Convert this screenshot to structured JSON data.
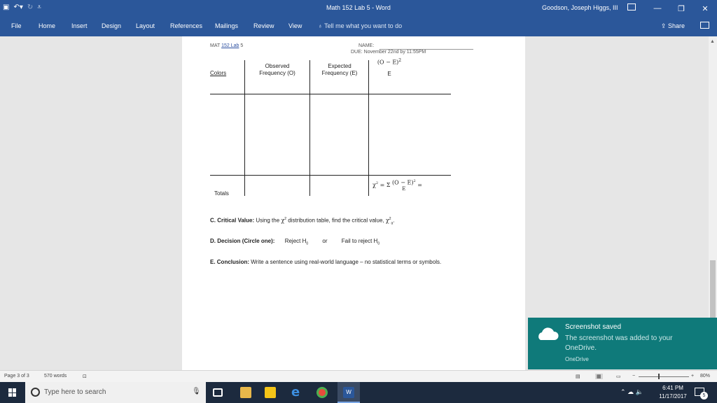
{
  "app": {
    "title": "Math 152 Lab 5  -  Word",
    "user": "Goodson, Joseph Higgs, III",
    "quick_access": [
      "save-icon",
      "undo-icon",
      "redo-icon",
      "customize-icon"
    ]
  },
  "ribbon": {
    "tabs": [
      "File",
      "Home",
      "Insert",
      "Design",
      "Layout",
      "References",
      "Mailings",
      "Review",
      "View"
    ],
    "tell_me": "Tell me what you want to do",
    "share": "Share"
  },
  "document": {
    "header_left_prefix": "MAT ",
    "header_left_ul": "152 Lab",
    "header_left_suffix": " 5",
    "name_label": "NAME:",
    "due": "DUE: November 22nd by 11:55PM",
    "table": {
      "col_colors": "Colors",
      "col_observed_1": "Observed",
      "col_observed_2": "Frequency (O)",
      "col_expected_1": "Expected",
      "col_expected_2": "Frequency (E)",
      "col_formula_num": "(O − E)",
      "col_formula_exp": "2",
      "col_formula_den": "E",
      "totals": "Totals",
      "chi_lhs": "χ",
      "chi_sup": "2",
      "chi_eq": " = Σ",
      "chi_num": "(O − E)",
      "chi_num_exp": "2",
      "chi_den": "E",
      "chi_end": " ="
    },
    "critical_value": {
      "label": "C. Critical Value:",
      "text1": " Using the ",
      "chi": "χ",
      "chi_sup": "2",
      "text2": " distribution table, find the critical value, ",
      "chi2": "χ",
      "chi2_sup": "2",
      "chi2_sub": "α",
      "text3": "."
    },
    "decision": {
      "label": "D. Decision (Circle one):",
      "reject": "Reject H",
      "reject_sub": "0",
      "or": "or",
      "fail": "Fail to reject H",
      "fail_sub": "0"
    },
    "conclusion": {
      "label": "E. Conclusion:",
      "text": " Write a sentence using real-world language – no statistical terms or symbols."
    }
  },
  "statusbar": {
    "page": "Page 3 of 3",
    "words": "570 words",
    "zoom": "80%"
  },
  "toast": {
    "title": "Screenshot saved",
    "body": "The screenshot was added to your OneDrive.",
    "source": "OneDrive"
  },
  "taskbar": {
    "search_placeholder": "Type here to search",
    "time": "6:41 PM",
    "date": "11/17/2017",
    "notifications": "5"
  },
  "colors": {
    "word_blue": "#2b579a",
    "taskbar": "#1c2a3e",
    "toast": "#0f7a7a"
  }
}
